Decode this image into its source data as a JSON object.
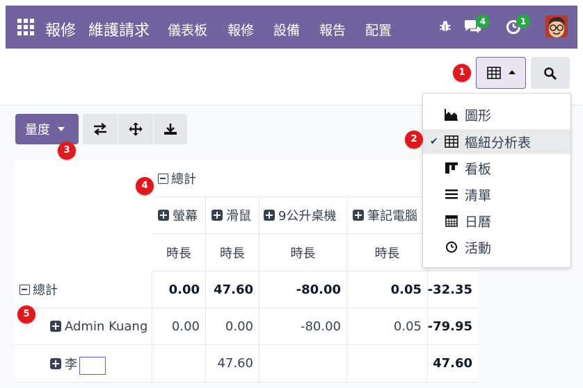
{
  "topbar": {
    "brand": "報修",
    "section": "維護請求",
    "nav": [
      "儀表板",
      "報修",
      "設備",
      "報告",
      "配置"
    ],
    "messages_count": "4",
    "activities_count": "1"
  },
  "controls": {
    "measures_label": "量度"
  },
  "markers": [
    "1",
    "2",
    "3",
    "4",
    "5"
  ],
  "view_menu": {
    "items": [
      {
        "label": "圖形",
        "icon": "area-chart-icon",
        "active": false
      },
      {
        "label": "樞紐分析表",
        "icon": "table-icon",
        "active": true
      },
      {
        "label": "看板",
        "icon": "kanban-icon",
        "active": false
      },
      {
        "label": "清單",
        "icon": "list-icon",
        "active": false
      },
      {
        "label": "日曆",
        "icon": "calendar-icon",
        "active": false
      },
      {
        "label": "活動",
        "icon": "clock-icon",
        "active": false
      }
    ]
  },
  "pivot": {
    "col_total_label": "總計",
    "columns": [
      "螢幕",
      "滑鼠",
      "9公升桌機",
      "筆記電腦"
    ],
    "measure_label": "時長",
    "rows": [
      {
        "label": "總計",
        "values": [
          "0.00",
          "47.60",
          "-80.00",
          "0.05",
          "-32.35"
        ]
      },
      {
        "label": "Admin Kuang",
        "values": [
          "0.00",
          "0.00",
          "-80.00",
          "0.05",
          "-79.95"
        ]
      },
      {
        "label": "李",
        "values": [
          "",
          "47.60",
          "",
          "",
          "47.60"
        ]
      }
    ]
  },
  "colors": {
    "primary": "#71639e",
    "marker": "#e0191e",
    "badge": "#28a745"
  }
}
